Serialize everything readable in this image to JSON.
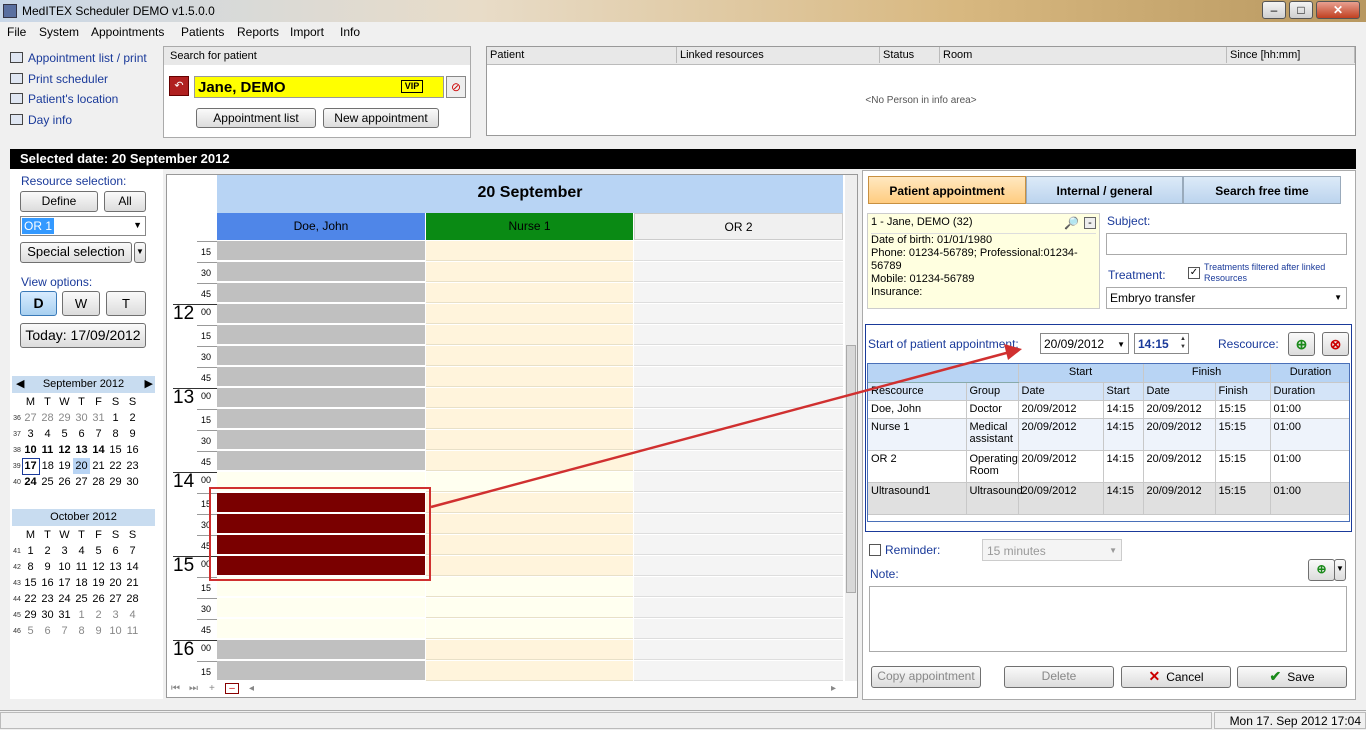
{
  "app": {
    "title": "MedITEX  Scheduler DEMO v1.5.0.0"
  },
  "menu": [
    "File",
    "System",
    "Appointments",
    "Patients",
    "Reports",
    "Import",
    "Info"
  ],
  "sidelinks": [
    "Appointment list / print",
    "Print scheduler",
    "Patient's location",
    "Day info"
  ],
  "search": {
    "label": "Search for patient",
    "value": "Jane, DEMO",
    "vip": "VIP",
    "appt_list": "Appointment list",
    "new_appt": "New appointment"
  },
  "info_area": {
    "cols": [
      "Patient",
      "Linked resources",
      "Status",
      "Room",
      "Since [hh:mm]"
    ],
    "empty": "<No Person in info area>"
  },
  "selected_date": "Selected date: 20 September 2012",
  "left": {
    "resource_selection": "Resource selection:",
    "define": "Define",
    "all": "All",
    "resource_value": "OR 1",
    "special": "Special selection",
    "view_options": "View options:",
    "views": [
      "D",
      "W",
      "T"
    ],
    "today": "Today: 17/09/2012"
  },
  "cal_sep": {
    "title": "September 2012",
    "dow": [
      "M",
      "T",
      "W",
      "T",
      "F",
      "S",
      "S"
    ],
    "rows": [
      {
        "wk": "36",
        "d": [
          "27",
          "28",
          "29",
          "30",
          "31",
          "1",
          "2"
        ]
      },
      {
        "wk": "37",
        "d": [
          "3",
          "4",
          "5",
          "6",
          "7",
          "8",
          "9"
        ]
      },
      {
        "wk": "38",
        "d": [
          "10",
          "11",
          "12",
          "13",
          "14",
          "15",
          "16"
        ]
      },
      {
        "wk": "39",
        "d": [
          "17",
          "18",
          "19",
          "20",
          "21",
          "22",
          "23"
        ]
      },
      {
        "wk": "40",
        "d": [
          "24",
          "25",
          "26",
          "27",
          "28",
          "29",
          "30"
        ]
      }
    ]
  },
  "cal_oct": {
    "title": "October 2012",
    "dow": [
      "M",
      "T",
      "W",
      "T",
      "F",
      "S",
      "S"
    ],
    "rows": [
      {
        "wk": "41",
        "d": [
          "1",
          "2",
          "3",
          "4",
          "5",
          "6",
          "7"
        ]
      },
      {
        "wk": "42",
        "d": [
          "8",
          "9",
          "10",
          "11",
          "12",
          "13",
          "14"
        ]
      },
      {
        "wk": "43",
        "d": [
          "15",
          "16",
          "17",
          "18",
          "19",
          "20",
          "21"
        ]
      },
      {
        "wk": "44",
        "d": [
          "22",
          "23",
          "24",
          "25",
          "26",
          "27",
          "28"
        ]
      },
      {
        "wk": "45",
        "d": [
          "29",
          "30",
          "31",
          "1",
          "2",
          "3",
          "4"
        ]
      },
      {
        "wk": "46",
        "d": [
          "5",
          "6",
          "7",
          "8",
          "9",
          "10",
          "11"
        ]
      }
    ]
  },
  "schedule": {
    "date_header": "20 September",
    "columns": [
      "Doe, John",
      "Nurse 1",
      "OR 2"
    ],
    "hours": [
      "12",
      "13",
      "14",
      "15",
      "16"
    ],
    "minutes": [
      "00",
      "15",
      "30",
      "45"
    ]
  },
  "tabs": [
    "Patient appointment",
    "Internal / general",
    "Search free time"
  ],
  "patient": {
    "name": "1 - Jane, DEMO (32)",
    "dob": "Date of birth: 01/01/1980",
    "phone": "Phone: 01234-56789; Professional:01234-56789",
    "mobile": "Mobile: 01234-56789",
    "insurance": "Insurance:"
  },
  "subject_label": "Subject:",
  "treatment": {
    "label": "Treatment:",
    "filter_note": "Treatments filtered after linked Resources",
    "value": "Embryo transfer"
  },
  "appt": {
    "start_label": "Start of patient appointment:",
    "date": "20/09/2012",
    "time": "14:15",
    "resource_label": "Rescource:"
  },
  "res_table": {
    "group_start": "Start",
    "group_finish": "Finish",
    "group_duration": "Duration",
    "headers": [
      "Rescource",
      "Group",
      "Date",
      "Start",
      "Date",
      "Finish",
      "Duration"
    ],
    "rows": [
      [
        "Doe, John",
        "Doctor",
        "20/09/2012",
        "14:15",
        "20/09/2012",
        "15:15",
        "01:00"
      ],
      [
        "Nurse 1",
        "Medical assistant",
        "20/09/2012",
        "14:15",
        "20/09/2012",
        "15:15",
        "01:00"
      ],
      [
        "OR 2",
        "Operating Room",
        "20/09/2012",
        "14:15",
        "20/09/2012",
        "15:15",
        "01:00"
      ],
      [
        "Ultrasound1",
        "Ultrasound",
        "20/09/2012",
        "14:15",
        "20/09/2012",
        "15:15",
        "01:00"
      ]
    ]
  },
  "reminder": {
    "label": "Reminder:",
    "value": "15 minutes"
  },
  "note_label": "Note:",
  "buttons": {
    "copy": "Copy appointment",
    "delete": "Delete",
    "cancel": "Cancel",
    "save": "Save"
  },
  "status": "Mon 17. Sep 2012 17:04"
}
